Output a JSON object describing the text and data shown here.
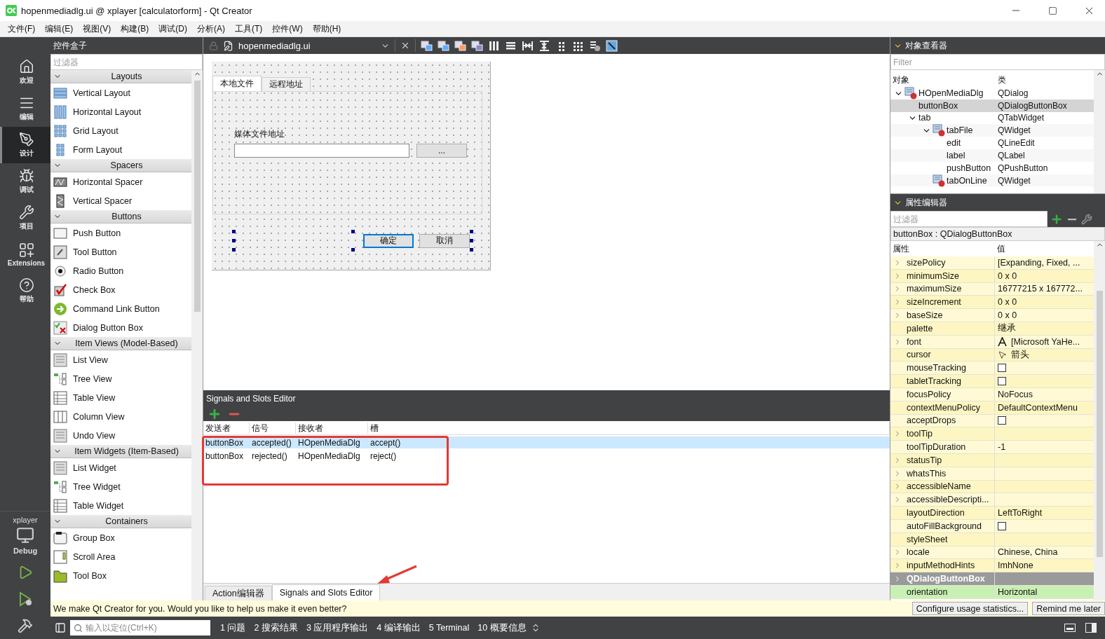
{
  "window": {
    "title": "hopenmediadlg.ui @ xplayer [calculatorform] - Qt Creator"
  },
  "menu": [
    "文件(F)",
    "编辑(E)",
    "视图(V)",
    "构建(B)",
    "调试(D)",
    "分析(A)",
    "工具(T)",
    "控件(W)",
    "帮助(H)"
  ],
  "modes": [
    {
      "label": "欢迎",
      "kind": "home",
      "selected": false
    },
    {
      "label": "编辑",
      "kind": "edit",
      "selected": false
    },
    {
      "label": "设计",
      "kind": "design",
      "selected": true
    },
    {
      "label": "调试",
      "kind": "debug",
      "selected": false
    },
    {
      "label": "项目",
      "kind": "project",
      "selected": false
    },
    {
      "label": "Extensions",
      "kind": "extensions",
      "selected": false
    },
    {
      "label": "帮助",
      "kind": "help",
      "selected": false
    }
  ],
  "kit": {
    "project": "xplayer",
    "config": "Debug"
  },
  "widget_box": {
    "title": "控件盒子",
    "filter_placeholder": "过滤器",
    "groups": [
      {
        "title": "Layouts",
        "expanded": true,
        "items": [
          "Vertical Layout",
          "Horizontal Layout",
          "Grid Layout",
          "Form Layout"
        ]
      },
      {
        "title": "Spacers",
        "expanded": true,
        "items": [
          "Horizontal Spacer",
          "Vertical Spacer"
        ]
      },
      {
        "title": "Buttons",
        "expanded": true,
        "items": [
          "Push Button",
          "Tool Button",
          "Radio Button",
          "Check Box",
          "Command Link Button",
          "Dialog Button Box"
        ]
      },
      {
        "title": "Item Views (Model-Based)",
        "expanded": true,
        "items": [
          "List View",
          "Tree View",
          "Table View",
          "Column View",
          "Undo View"
        ]
      },
      {
        "title": "Item Widgets (Item-Based)",
        "expanded": true,
        "items": [
          "List Widget",
          "Tree Widget",
          "Table Widget"
        ]
      },
      {
        "title": "Containers",
        "expanded": true,
        "items": [
          "Group Box",
          "Scroll Area",
          "Tool Box"
        ]
      }
    ]
  },
  "editor": {
    "file": "hopenmediadlg.ui",
    "form": {
      "tabs": [
        {
          "label": "本地文件",
          "selected": true
        },
        {
          "label": "远程地址",
          "selected": false
        }
      ],
      "label": "媒体文件地址",
      "browse": "...",
      "buttons": [
        {
          "label": "确定",
          "default": true
        },
        {
          "label": "取消",
          "default": false
        }
      ]
    }
  },
  "signals_editor": {
    "title": "Signals and Slots Editor",
    "columns": [
      "发送者",
      "信号",
      "接收者",
      "槽"
    ],
    "rows": [
      {
        "cells": [
          "buttonBox",
          "accepted()",
          "HOpenMediaDlg",
          "accept()"
        ],
        "selected": true
      },
      {
        "cells": [
          "buttonBox",
          "rejected()",
          "HOpenMediaDlg",
          "reject()"
        ],
        "selected": false
      }
    ]
  },
  "bottom_tabs": [
    {
      "label": "Action编辑器",
      "selected": false
    },
    {
      "label": "Signals and Slots Editor",
      "selected": true
    }
  ],
  "object_inspector": {
    "title": "对象查看器",
    "filter_placeholder": "Filter",
    "columns": [
      "对象",
      "类"
    ],
    "tree": [
      {
        "name": "HOpenMediaDlg",
        "class": "QDialog",
        "kind": "widget",
        "selected": false,
        "expanded": true,
        "children": [
          {
            "name": "buttonBox",
            "class": "QDialogButtonBox",
            "selected": true
          },
          {
            "name": "tab",
            "class": "QTabWidget",
            "selected": false,
            "expanded": true,
            "children": [
              {
                "name": "tabFile",
                "class": "QWidget",
                "kind": "widget",
                "selected": false,
                "expanded": true,
                "children": [
                  {
                    "name": "edit",
                    "class": "QLineEdit",
                    "selected": false
                  },
                  {
                    "name": "label",
                    "class": "QLabel",
                    "selected": false
                  },
                  {
                    "name": "pushButton",
                    "class": "QPushButton",
                    "selected": false
                  }
                ]
              },
              {
                "name": "tabOnLine",
                "class": "QWidget",
                "kind": "widget",
                "selected": false
              }
            ]
          }
        ]
      }
    ]
  },
  "property_editor": {
    "title": "属性编辑器",
    "filter_placeholder": "过滤器",
    "object": "buttonBox : QDialogButtonBox",
    "columns": [
      "属性",
      "值"
    ],
    "rows": [
      {
        "name": "sizePolicy",
        "value": "[Expanding, Fixed, ...",
        "kind": "text",
        "expandable": true
      },
      {
        "name": "minimumSize",
        "value": "0 x 0",
        "kind": "text",
        "expandable": true
      },
      {
        "name": "maximumSize",
        "value": "16777215 x 167772...",
        "kind": "text",
        "expandable": true
      },
      {
        "name": "sizeIncrement",
        "value": "0 x 0",
        "kind": "text",
        "expandable": true
      },
      {
        "name": "baseSize",
        "value": "0 x 0",
        "kind": "text",
        "expandable": true
      },
      {
        "name": "palette",
        "value": "继承",
        "kind": "text",
        "expandable": false
      },
      {
        "name": "font",
        "value": "[Microsoft YaHe...",
        "kind": "font",
        "expandable": true
      },
      {
        "name": "cursor",
        "value": "箭头",
        "kind": "cursor",
        "expandable": false
      },
      {
        "name": "mouseTracking",
        "kind": "checkbox",
        "checked": false,
        "expandable": false
      },
      {
        "name": "tabletTracking",
        "kind": "checkbox",
        "checked": false,
        "expandable": false
      },
      {
        "name": "focusPolicy",
        "value": "NoFocus",
        "kind": "text",
        "expandable": false
      },
      {
        "name": "contextMenuPolicy",
        "value": "DefaultContextMenu",
        "kind": "text",
        "expandable": false
      },
      {
        "name": "acceptDrops",
        "kind": "checkbox",
        "checked": false,
        "expandable": false
      },
      {
        "name": "toolTip",
        "kind": "text",
        "expandable": true
      },
      {
        "name": "toolTipDuration",
        "value": "-1",
        "kind": "text",
        "expandable": false
      },
      {
        "name": "statusTip",
        "kind": "text",
        "expandable": true
      },
      {
        "name": "whatsThis",
        "kind": "text",
        "expandable": true
      },
      {
        "name": "accessibleName",
        "kind": "text",
        "expandable": true
      },
      {
        "name": "accessibleDescripti...",
        "kind": "text",
        "expandable": true
      },
      {
        "name": "layoutDirection",
        "value": "LeftToRight",
        "kind": "text",
        "expandable": false
      },
      {
        "name": "autoFillBackground",
        "kind": "checkbox",
        "checked": false,
        "expandable": false
      },
      {
        "name": "styleSheet",
        "kind": "text",
        "expandable": false
      },
      {
        "name": "locale",
        "value": "Chinese, China",
        "kind": "text",
        "expandable": true
      },
      {
        "name": "inputMethodHints",
        "value": "ImhNone",
        "kind": "text",
        "expandable": true
      },
      {
        "name": "QDialogButtonBox",
        "kind": "section",
        "expandable": true
      },
      {
        "name": "orientation",
        "value": "Horizontal",
        "kind": "text",
        "expandable": false
      }
    ]
  },
  "info_bar": {
    "message": "We make Qt Creator for you. Would you like to help us make it even better?",
    "buttons": [
      "Configure usage statistics...",
      "Remind me later"
    ]
  },
  "status_bar": {
    "locator_placeholder": "输入以定位(Ctrl+K)",
    "panes": [
      "1 问题",
      "2 搜索结果",
      "3 应用程序输出",
      "4 编译输出",
      "5 Terminal",
      "10 概要信息"
    ]
  }
}
